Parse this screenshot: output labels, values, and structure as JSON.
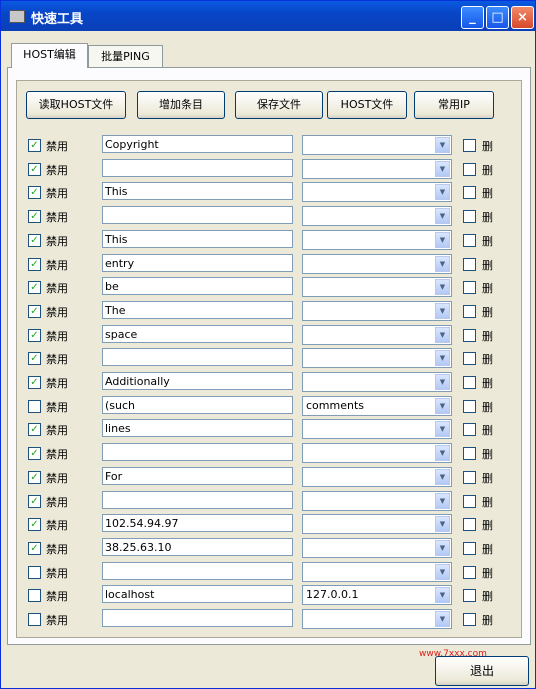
{
  "window": {
    "title": "快速工具",
    "icon": "app-icon",
    "controls": {
      "minimize": "_",
      "maximize": "□",
      "close": "×"
    }
  },
  "tabs": [
    {
      "label": "HOST编辑",
      "active": true
    },
    {
      "label": "批量PING",
      "active": false
    }
  ],
  "toolbar": {
    "read_host": "读取HOST文件",
    "add_entry": "增加条目",
    "save_file": "保存文件",
    "host_file": "HOST文件",
    "common_ip": "常用IP"
  },
  "rows": [
    {
      "disable_checked": true,
      "disable_label": "禁用",
      "host": "Copyright",
      "ip": "",
      "delete_label": "删",
      "delete_checked": false
    },
    {
      "disable_checked": true,
      "disable_label": "禁用",
      "host": "",
      "ip": "",
      "delete_label": "删",
      "delete_checked": false
    },
    {
      "disable_checked": true,
      "disable_label": "禁用",
      "host": "This",
      "ip": "",
      "delete_label": "删",
      "delete_checked": false
    },
    {
      "disable_checked": true,
      "disable_label": "禁用",
      "host": "",
      "ip": "",
      "delete_label": "删",
      "delete_checked": false
    },
    {
      "disable_checked": true,
      "disable_label": "禁用",
      "host": "This",
      "ip": "",
      "delete_label": "删",
      "delete_checked": false
    },
    {
      "disable_checked": true,
      "disable_label": "禁用",
      "host": "entry",
      "ip": "",
      "delete_label": "删",
      "delete_checked": false
    },
    {
      "disable_checked": true,
      "disable_label": "禁用",
      "host": "be",
      "ip": "",
      "delete_label": "删",
      "delete_checked": false
    },
    {
      "disable_checked": true,
      "disable_label": "禁用",
      "host": "The",
      "ip": "",
      "delete_label": "删",
      "delete_checked": false
    },
    {
      "disable_checked": true,
      "disable_label": "禁用",
      "host": "space",
      "ip": "",
      "delete_label": "删",
      "delete_checked": false
    },
    {
      "disable_checked": true,
      "disable_label": "禁用",
      "host": "",
      "ip": "",
      "delete_label": "删",
      "delete_checked": false
    },
    {
      "disable_checked": true,
      "disable_label": "禁用",
      "host": "Additionally",
      "ip": "",
      "delete_label": "删",
      "delete_checked": false
    },
    {
      "disable_checked": false,
      "disable_label": "禁用",
      "host": "(such",
      "ip": "comments",
      "delete_label": "删",
      "delete_checked": false
    },
    {
      "disable_checked": true,
      "disable_label": "禁用",
      "host": "lines",
      "ip": "",
      "delete_label": "删",
      "delete_checked": false
    },
    {
      "disable_checked": true,
      "disable_label": "禁用",
      "host": "",
      "ip": "",
      "delete_label": "删",
      "delete_checked": false
    },
    {
      "disable_checked": true,
      "disable_label": "禁用",
      "host": "For",
      "ip": "",
      "delete_label": "删",
      "delete_checked": false
    },
    {
      "disable_checked": true,
      "disable_label": "禁用",
      "host": "",
      "ip": "",
      "delete_label": "删",
      "delete_checked": false
    },
    {
      "disable_checked": true,
      "disable_label": "禁用",
      "host": "102.54.94.97",
      "ip": "",
      "delete_label": "删",
      "delete_checked": false
    },
    {
      "disable_checked": true,
      "disable_label": "禁用",
      "host": "38.25.63.10",
      "ip": "",
      "delete_label": "删",
      "delete_checked": false
    },
    {
      "disable_checked": false,
      "disable_label": "禁用",
      "host": "",
      "ip": "",
      "delete_label": "删",
      "delete_checked": false
    },
    {
      "disable_checked": false,
      "disable_label": "禁用",
      "host": "localhost",
      "ip": "127.0.0.1",
      "delete_label": "删",
      "delete_checked": false
    },
    {
      "disable_checked": false,
      "disable_label": "禁用",
      "host": "",
      "ip": "",
      "delete_label": "删",
      "delete_checked": false
    }
  ],
  "footer": {
    "watermark": "www.7xxx.com",
    "exit": "退出"
  },
  "colors": {
    "titlebar": "#0a4fd6",
    "face": "#ece9d8",
    "check_mark": "#21a121",
    "watermark": "#e0201c"
  }
}
